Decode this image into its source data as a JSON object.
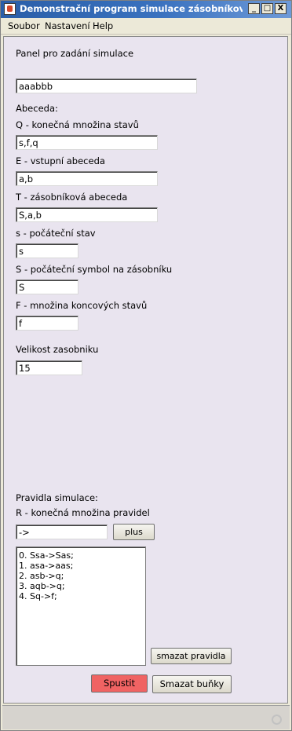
{
  "window": {
    "title": "Demonstrační program simulace zásobníkových a...",
    "minimize_label": "_",
    "maximize_label": "□",
    "close_label": "X"
  },
  "menu": {
    "items": [
      "Soubor",
      "Nastavení",
      "Help"
    ]
  },
  "panel": {
    "heading": "Panel pro zadání simulace",
    "input_word": "aaabbb",
    "alphabet_heading": "Abeceda:",
    "q_label": "Q - konečná množina stavů",
    "q_value": "s,f,q",
    "e_label": "E - vstupní abeceda",
    "e_value": "a,b",
    "t_label": "T - zásobníková abeceda",
    "t_value": "S,a,b",
    "s_label": "s - počáteční stav",
    "s_value": "s",
    "S_label": "S - počáteční symbol na zásobníku",
    "S_value": "S",
    "f_label": "F - množina koncových stavů",
    "f_value": "f",
    "stack_label": "Velikost zasobniku",
    "stack_value": "15",
    "rules_heading": "Pravidla simulace:",
    "r_label": "R - konečná množina pravidel",
    "rule_input": "->",
    "plus_button": "plus",
    "rules": [
      "0. Ssa->Sas;",
      "1. asa->aas;",
      "2. asb->q;",
      "3. aqb->q;",
      "4. Sq->f;"
    ],
    "clear_rules_button": "smazat pravidla",
    "run_button": "Spustit",
    "clear_cells_button": "Smazat buňky",
    "run_button_color": "#f06363"
  }
}
